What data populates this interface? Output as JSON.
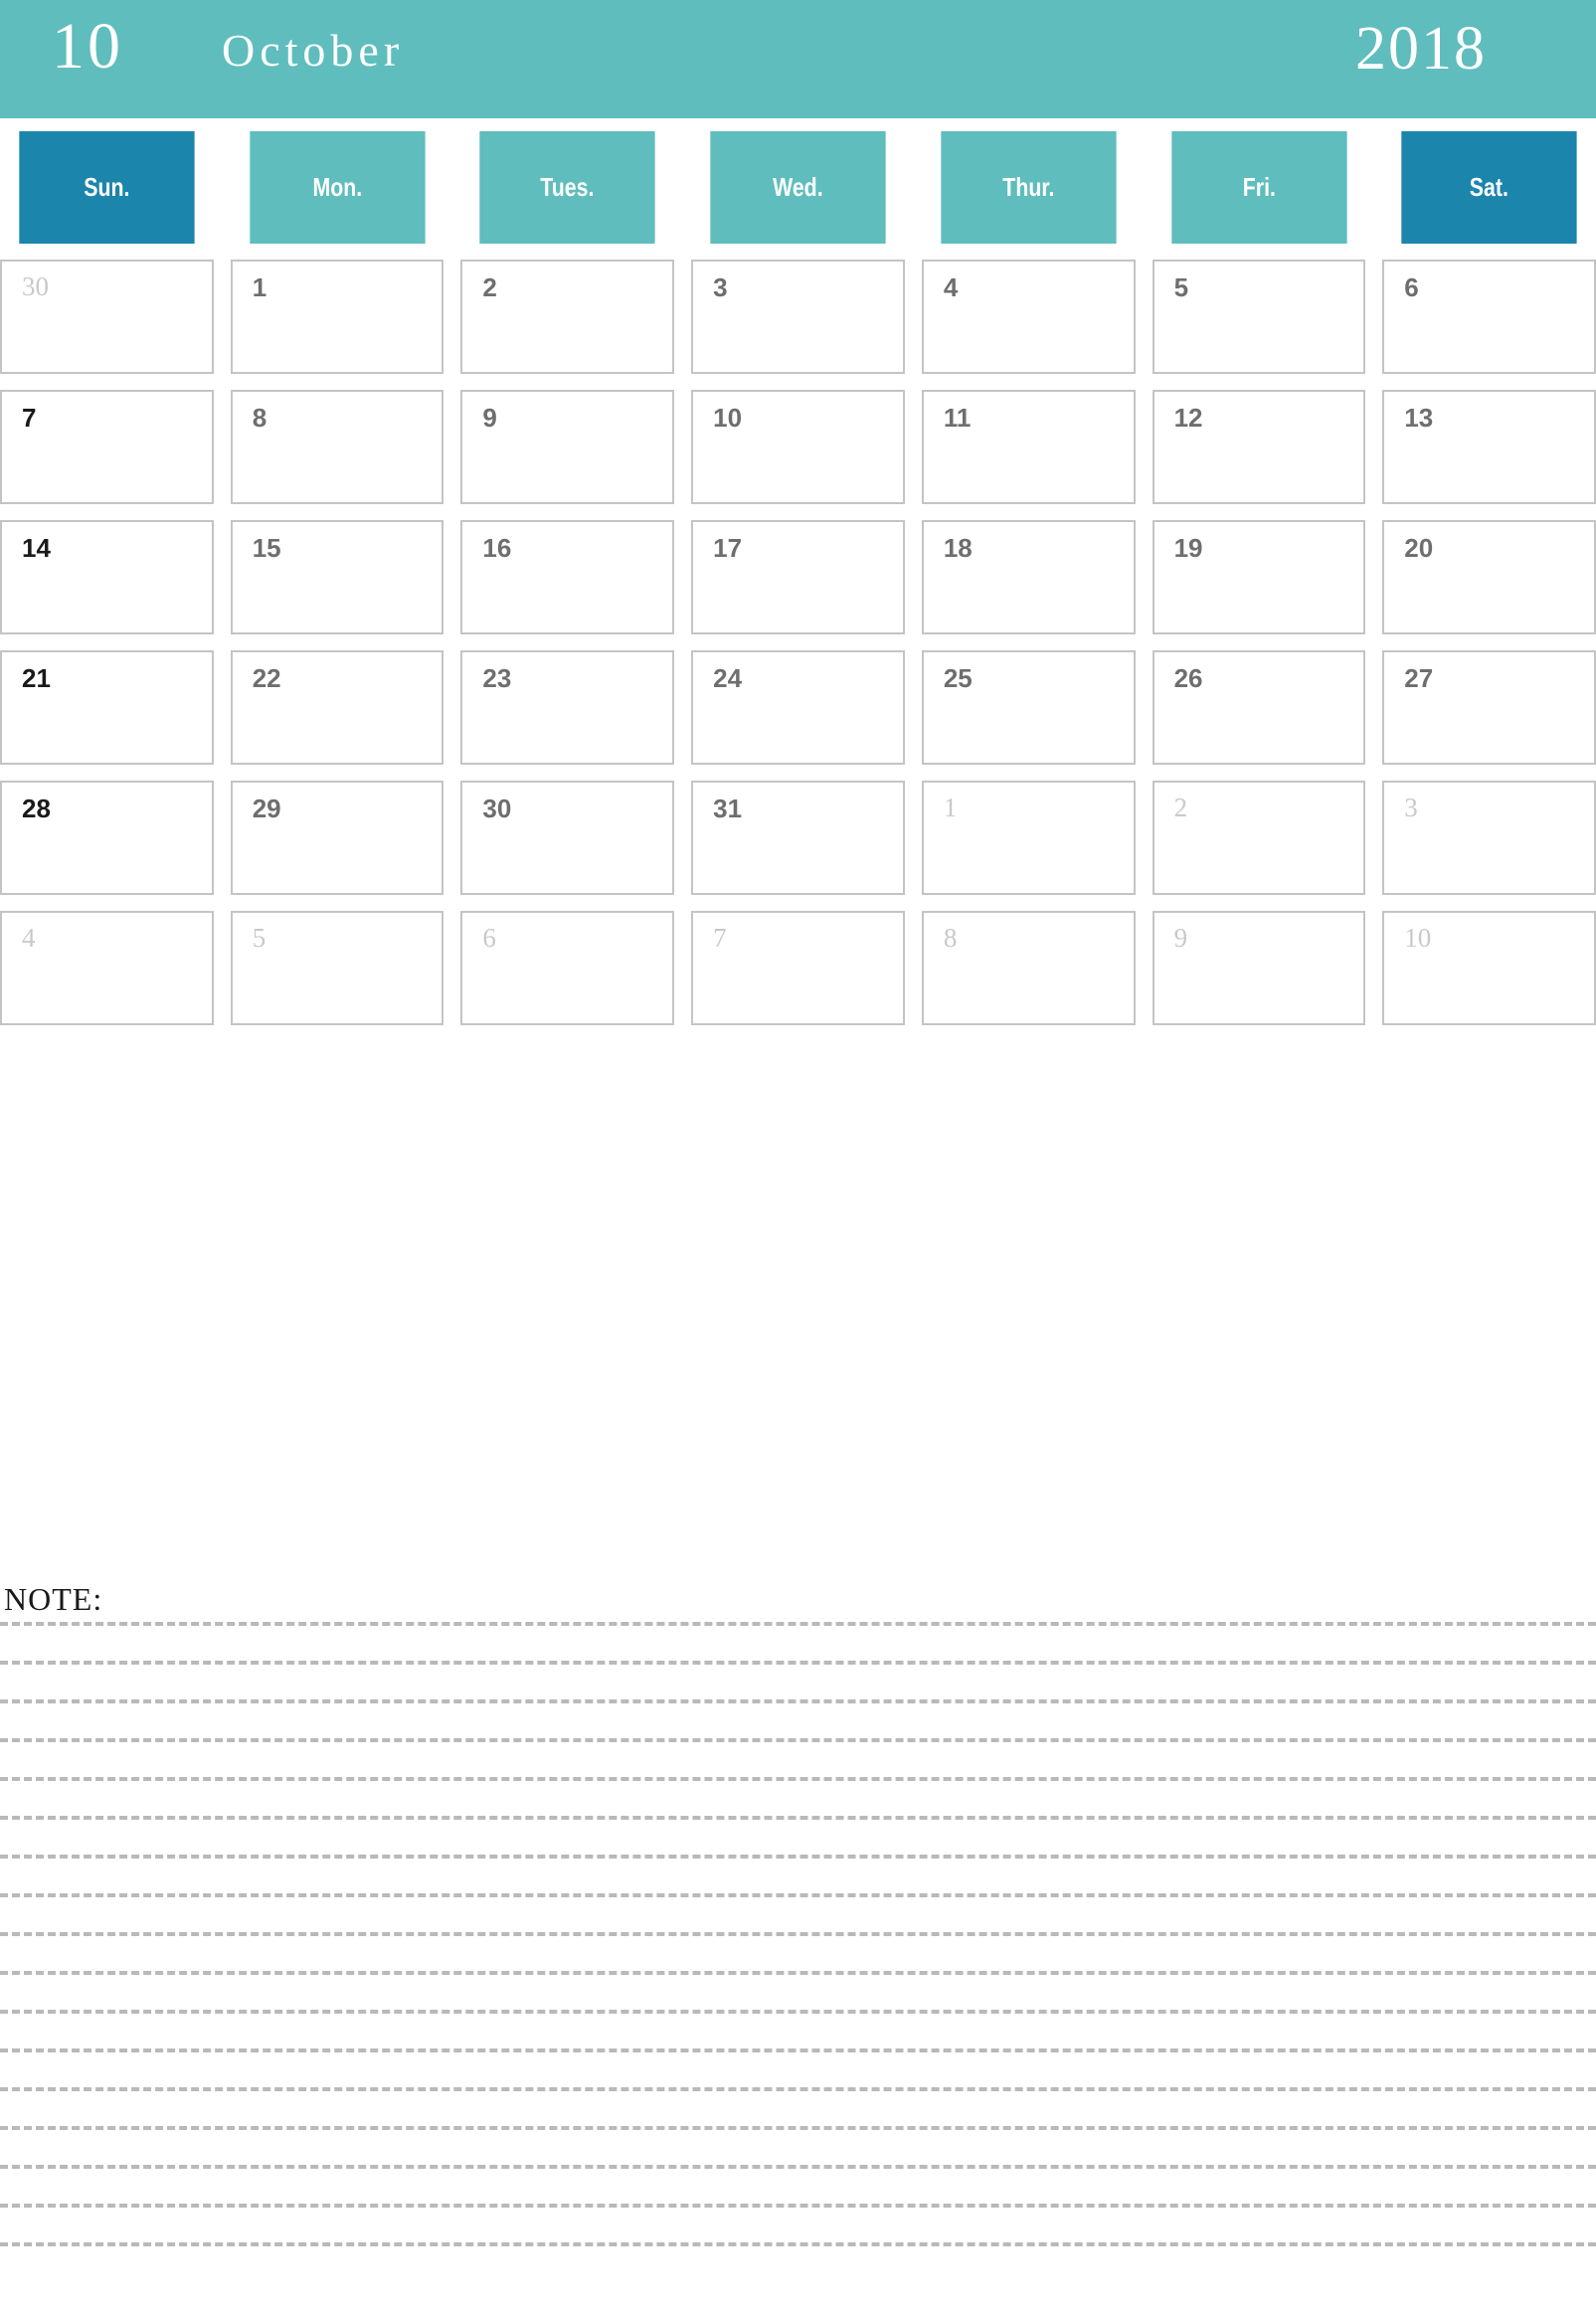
{
  "header": {
    "month_number": "10",
    "month_name": "October",
    "year": "2018",
    "banner_color": "#5fbdbd"
  },
  "weekdays": [
    {
      "label": "Sun.",
      "weekend": true,
      "color": "#1b85ac"
    },
    {
      "label": "Mon.",
      "weekend": false,
      "color": "#5fbdbd"
    },
    {
      "label": "Tues.",
      "weekend": false,
      "color": "#5fbdbd"
    },
    {
      "label": "Wed.",
      "weekend": false,
      "color": "#5fbdbd"
    },
    {
      "label": "Thur.",
      "weekend": false,
      "color": "#5fbdbd"
    },
    {
      "label": "Fri.",
      "weekend": false,
      "color": "#5fbdbd"
    },
    {
      "label": "Sat.",
      "weekend": true,
      "color": "#1b85ac"
    }
  ],
  "weeks": [
    [
      {
        "day": "30",
        "current_month": false
      },
      {
        "day": "1",
        "current_month": true
      },
      {
        "day": "2",
        "current_month": true
      },
      {
        "day": "3",
        "current_month": true
      },
      {
        "day": "4",
        "current_month": true
      },
      {
        "day": "5",
        "current_month": true
      },
      {
        "day": "6",
        "current_month": true
      }
    ],
    [
      {
        "day": "7",
        "current_month": true
      },
      {
        "day": "8",
        "current_month": true
      },
      {
        "day": "9",
        "current_month": true
      },
      {
        "day": "10",
        "current_month": true
      },
      {
        "day": "11",
        "current_month": true
      },
      {
        "day": "12",
        "current_month": true
      },
      {
        "day": "13",
        "current_month": true
      }
    ],
    [
      {
        "day": "14",
        "current_month": true
      },
      {
        "day": "15",
        "current_month": true
      },
      {
        "day": "16",
        "current_month": true
      },
      {
        "day": "17",
        "current_month": true
      },
      {
        "day": "18",
        "current_month": true
      },
      {
        "day": "19",
        "current_month": true
      },
      {
        "day": "20",
        "current_month": true
      }
    ],
    [
      {
        "day": "21",
        "current_month": true
      },
      {
        "day": "22",
        "current_month": true
      },
      {
        "day": "23",
        "current_month": true
      },
      {
        "day": "24",
        "current_month": true
      },
      {
        "day": "25",
        "current_month": true
      },
      {
        "day": "26",
        "current_month": true
      },
      {
        "day": "27",
        "current_month": true
      }
    ],
    [
      {
        "day": "28",
        "current_month": true
      },
      {
        "day": "29",
        "current_month": true
      },
      {
        "day": "30",
        "current_month": true
      },
      {
        "day": "31",
        "current_month": true
      },
      {
        "day": "1",
        "current_month": false
      },
      {
        "day": "2",
        "current_month": false
      },
      {
        "day": "3",
        "current_month": false
      }
    ],
    [
      {
        "day": "4",
        "current_month": false
      },
      {
        "day": "5",
        "current_month": false
      },
      {
        "day": "6",
        "current_month": false
      },
      {
        "day": "7",
        "current_month": false
      },
      {
        "day": "8",
        "current_month": false
      },
      {
        "day": "9",
        "current_month": false
      },
      {
        "day": "10",
        "current_month": false
      }
    ]
  ],
  "note": {
    "label": "NOTE:",
    "line_count": 17,
    "line_color": "#b9b9b9"
  }
}
